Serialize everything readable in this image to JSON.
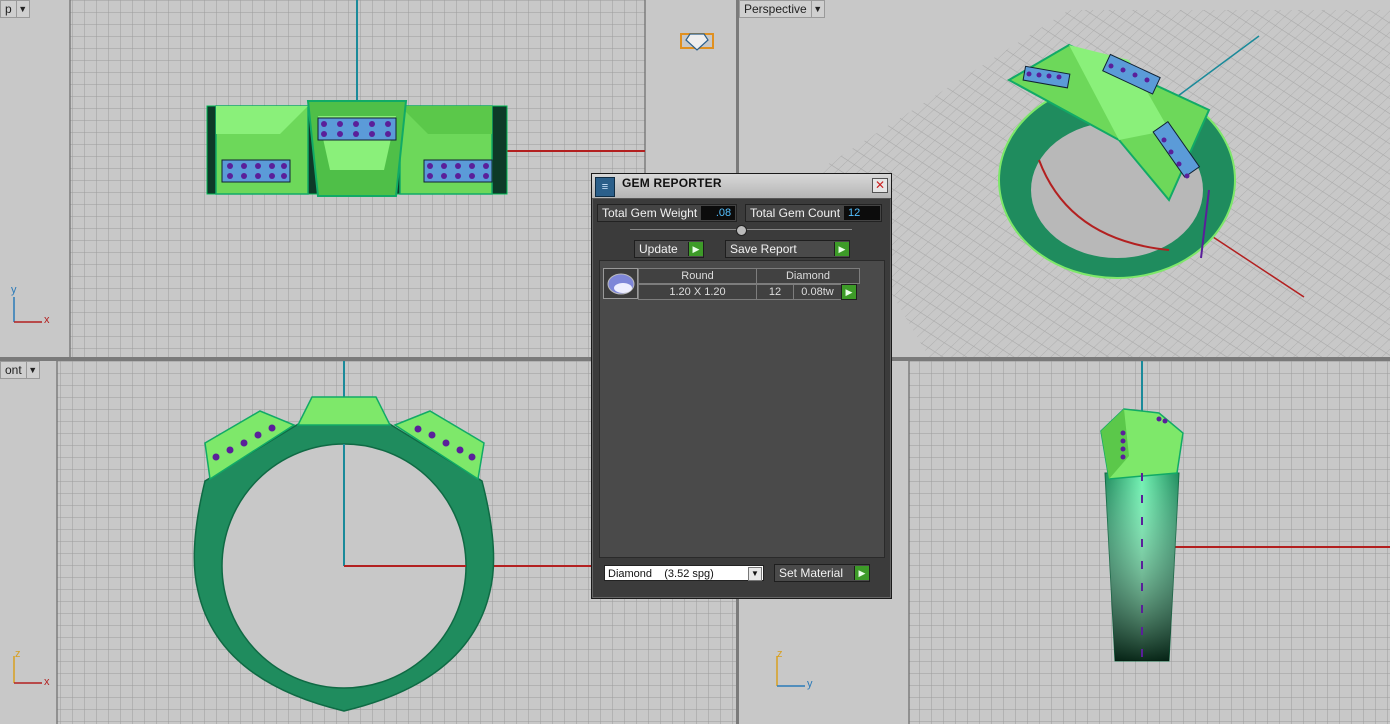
{
  "viewports": {
    "top": {
      "label": "p"
    },
    "perspective": {
      "label": "Perspective"
    },
    "front": {
      "label": "ont"
    },
    "right": {
      "label": ""
    }
  },
  "axes": {
    "top": {
      "v": "y",
      "h": "x"
    },
    "front": {
      "v": "z",
      "h": "x"
    },
    "right": {
      "v": "z",
      "h": "y"
    }
  },
  "gem_reporter": {
    "title": "GEM REPORTER",
    "total_weight_label": "Total Gem Weight",
    "total_weight_value": ".08",
    "total_count_label": "Total Gem Count",
    "total_count_value": "12",
    "update_label": "Update",
    "save_report_label": "Save Report",
    "table": {
      "shape_header": "Round",
      "material_header": "Diamond",
      "size": "1.20 X 1.20",
      "count": "12",
      "weight": "0.08tw"
    },
    "material_select": "Diamond    (3.52 spg)",
    "set_material_label": "Set Material"
  },
  "colors": {
    "viewport_bg": "#c8c8c8",
    "ring_light": "#7ee86a",
    "ring_dark": "#1f8c5e",
    "axis_red": "#b32020",
    "axis_teal": "#1a8a9a",
    "gem_purple": "#5a2a9a"
  }
}
